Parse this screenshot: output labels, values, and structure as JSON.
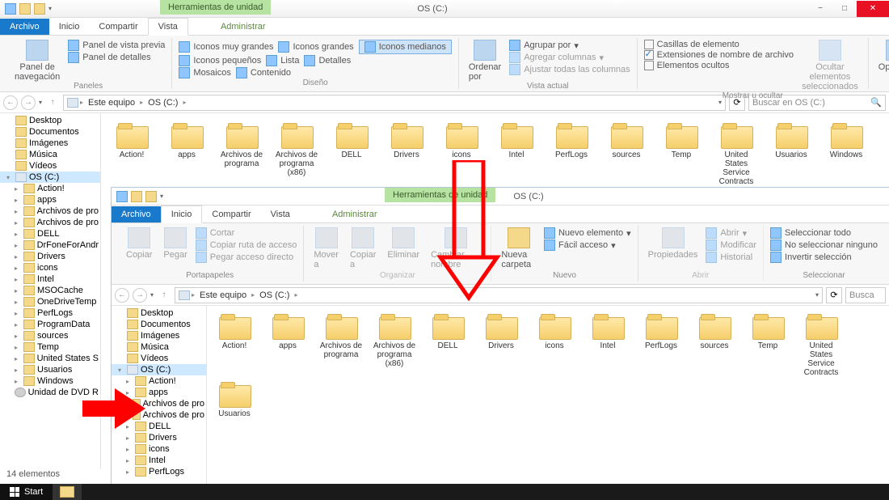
{
  "win1": {
    "ctxtools": "Herramientas de unidad",
    "title": "OS (C:)",
    "tabs": {
      "archivo": "Archivo",
      "inicio": "Inicio",
      "compartir": "Compartir",
      "vista": "Vista",
      "administrar": "Administrar"
    },
    "ribbon": {
      "panels": {
        "nav": "Panel de\nnavegación",
        "preview": "Panel de vista previa",
        "details": "Panel de detalles",
        "label": "Paneles"
      },
      "layout": {
        "xl": "Iconos muy grandes",
        "lg": "Iconos grandes",
        "md": "Iconos medianos",
        "sm": "Iconos pequeños",
        "list": "Lista",
        "det": "Detalles",
        "mosaic": "Mosaicos",
        "content": "Contenido",
        "label": "Diseño"
      },
      "sort": {
        "btn": "Ordenar por",
        "group": "Agrupar por",
        "cols": "Agregar columnas",
        "fit": "Ajustar todas las columnas",
        "label": "Vista actual"
      },
      "show": {
        "c1": "Casillas de elemento",
        "c2": "Extensiones de nombre de archivo",
        "c3": "Elementos ocultos",
        "hide": "Ocultar elementos\nseleccionados",
        "label": "Mostrar u ocultar"
      },
      "options": "Opciones"
    },
    "crumbs": [
      "Este equipo",
      "OS (C:)"
    ],
    "search": "Buscar en OS (C:)",
    "tree": [
      {
        "l": 0,
        "t": "folder",
        "n": "Desktop"
      },
      {
        "l": 0,
        "t": "folder",
        "n": "Documentos"
      },
      {
        "l": 0,
        "t": "folder",
        "n": "Imágenes"
      },
      {
        "l": 0,
        "t": "folder",
        "n": "Música"
      },
      {
        "l": 0,
        "t": "folder",
        "n": "Vídeos"
      },
      {
        "l": 0,
        "t": "drive",
        "n": "OS (C:)",
        "sel": true,
        "exp": true
      },
      {
        "l": 1,
        "t": "folder",
        "n": "Action!"
      },
      {
        "l": 1,
        "t": "folder",
        "n": "apps"
      },
      {
        "l": 1,
        "t": "folder",
        "n": "Archivos de pro"
      },
      {
        "l": 1,
        "t": "folder",
        "n": "Archivos de pro"
      },
      {
        "l": 1,
        "t": "folder",
        "n": "DELL"
      },
      {
        "l": 1,
        "t": "folder",
        "n": "DrFoneForAndr"
      },
      {
        "l": 1,
        "t": "folder",
        "n": "Drivers"
      },
      {
        "l": 1,
        "t": "folder",
        "n": "icons"
      },
      {
        "l": 1,
        "t": "folder",
        "n": "Intel"
      },
      {
        "l": 1,
        "t": "folder",
        "n": "MSOCache"
      },
      {
        "l": 1,
        "t": "folder",
        "n": "OneDriveTemp"
      },
      {
        "l": 1,
        "t": "folder",
        "n": "PerfLogs"
      },
      {
        "l": 1,
        "t": "folder",
        "n": "ProgramData"
      },
      {
        "l": 1,
        "t": "folder",
        "n": "sources"
      },
      {
        "l": 1,
        "t": "folder",
        "n": "Temp"
      },
      {
        "l": 1,
        "t": "folder",
        "n": "United States S"
      },
      {
        "l": 1,
        "t": "folder",
        "n": "Usuarios"
      },
      {
        "l": 1,
        "t": "folder",
        "n": "Windows"
      },
      {
        "l": 0,
        "t": "disc",
        "n": "Unidad de DVD R"
      }
    ],
    "files": [
      "Action!",
      "apps",
      "Archivos de programa",
      "Archivos de programa (x86)",
      "DELL",
      "Drivers",
      "icons",
      "Intel",
      "PerfLogs",
      "sources",
      "Temp",
      "United States Service Contracts",
      "Usuarios",
      "Windows"
    ],
    "status": "14 elementos"
  },
  "win2": {
    "ctxtools": "Herramientas de unidad",
    "title": "OS (C:)",
    "tabs": {
      "archivo": "Archivo",
      "inicio": "Inicio",
      "compartir": "Compartir",
      "vista": "Vista",
      "administrar": "Administrar"
    },
    "ribbon": {
      "clip": {
        "copy": "Copiar",
        "paste": "Pegar",
        "cut": "Cortar",
        "cpath": "Copiar ruta de acceso",
        "pshort": "Pegar acceso directo",
        "label": "Portapapeles"
      },
      "org": {
        "move": "Mover a",
        "copy": "Copiar a",
        "del": "Eliminar",
        "ren": "Cambiar nombre",
        "label": "Organizar"
      },
      "new": {
        "folder": "Nueva carpeta",
        "item": "Nuevo elemento",
        "easy": "Fácil acceso",
        "label": "Nuevo"
      },
      "open": {
        "props": "Propiedades",
        "open": "Abrir",
        "edit": "Modificar",
        "hist": "Historial",
        "label": "Abrir"
      },
      "sel": {
        "all": "Seleccionar todo",
        "none": "No seleccionar ninguno",
        "inv": "Invertir selección",
        "label": "Seleccionar"
      }
    },
    "crumbs": [
      "Este equipo",
      "OS (C:)"
    ],
    "search": "Busca",
    "tree": [
      {
        "l": 0,
        "t": "folder",
        "n": "Desktop"
      },
      {
        "l": 0,
        "t": "folder",
        "n": "Documentos"
      },
      {
        "l": 0,
        "t": "folder",
        "n": "Imágenes"
      },
      {
        "l": 0,
        "t": "folder",
        "n": "Música"
      },
      {
        "l": 0,
        "t": "folder",
        "n": "Vídeos"
      },
      {
        "l": 0,
        "t": "drive",
        "n": "OS (C:)",
        "sel": true,
        "exp": true
      },
      {
        "l": 1,
        "t": "folder",
        "n": "Action!"
      },
      {
        "l": 1,
        "t": "folder",
        "n": "apps"
      },
      {
        "l": 1,
        "t": "folder",
        "n": "Archivos de pro"
      },
      {
        "l": 1,
        "t": "folder",
        "n": "Archivos de pro"
      },
      {
        "l": 1,
        "t": "folder",
        "n": "DELL"
      },
      {
        "l": 1,
        "t": "folder",
        "n": "Drivers"
      },
      {
        "l": 1,
        "t": "folder",
        "n": "icons"
      },
      {
        "l": 1,
        "t": "folder",
        "n": "Intel"
      },
      {
        "l": 1,
        "t": "folder",
        "n": "PerfLogs"
      }
    ],
    "files": [
      "Action!",
      "apps",
      "Archivos de programa",
      "Archivos de programa (x86)",
      "DELL",
      "Drivers",
      "icons",
      "Intel",
      "PerfLogs",
      "sources",
      "Temp",
      "United States Service Contracts",
      "Usuarios"
    ]
  },
  "start": "Start"
}
